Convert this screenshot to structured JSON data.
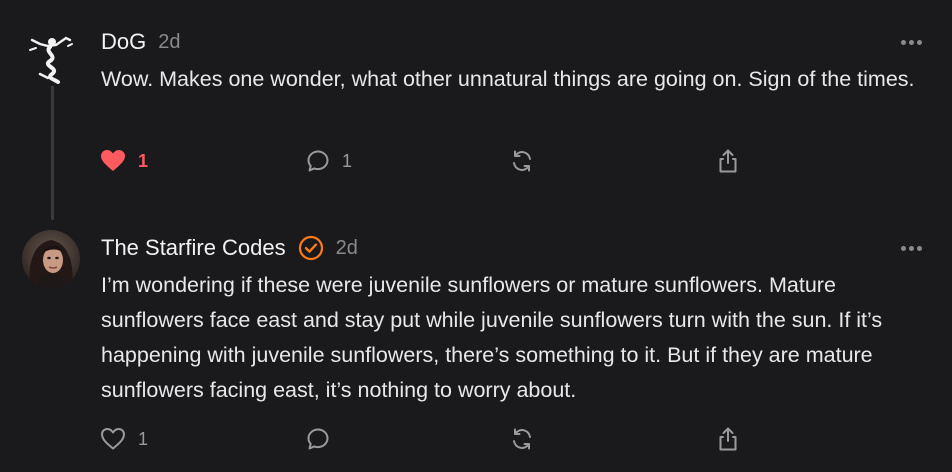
{
  "comments": [
    {
      "author": "DoG",
      "time": "2d",
      "text": "Wow. Makes one wonder, what other unnatural things are going on. Sign of the times.",
      "likes": "1",
      "liked": true,
      "replies": "1",
      "avatar_icon": "dancing-figure-avatar"
    },
    {
      "author": "The Starfire Codes",
      "time": "2d",
      "verified": true,
      "text": "I’m wondering if these were juvenile sunflowers or mature sunflowers. Mature sunflowers face east and stay put while juvenile sunflowers turn with the sun. If it’s happening with juvenile sunflowers, there’s something to it. But if they are mature sunflowers facing east, it’s nothing to worry about.",
      "likes": "1",
      "liked": false,
      "replies": "",
      "avatar_icon": "profile-photo-avatar"
    }
  ],
  "icons": {
    "like": "heart-icon",
    "reply": "speech-bubble-icon",
    "restack": "restack-arrows-icon",
    "share": "share-upload-icon",
    "more": "ellipsis-icon",
    "verified": "verified-badge-icon"
  },
  "colors": {
    "background": "#1a1a1c",
    "like_active": "#ff5a5f",
    "verified_badge": "#ff7a1a",
    "muted": "#8a8a8e"
  }
}
